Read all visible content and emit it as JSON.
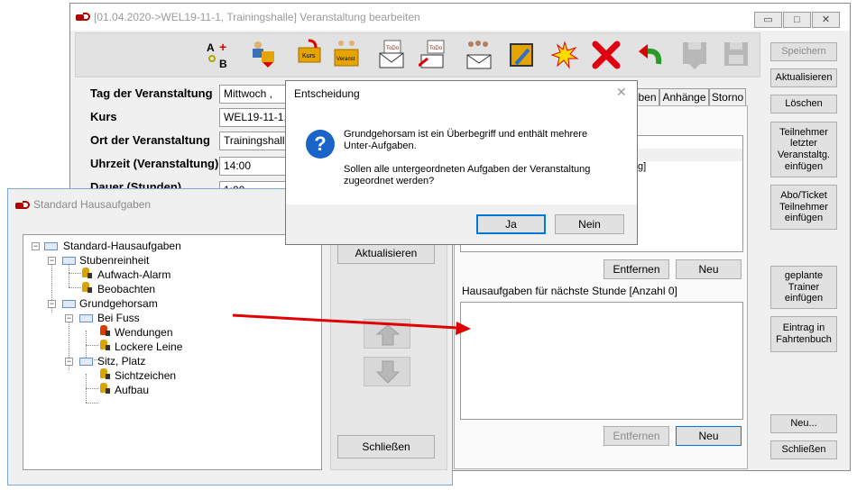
{
  "main_window": {
    "title": "[01.04.2020->WEL19-11-1, Trainingshalle] Veranstaltung bearbeiten",
    "controls": {
      "minimize": "▭",
      "maximize": "□",
      "close": "✕"
    },
    "toolbar_icons": [
      "ab-text-icon",
      "trainer-event-icon",
      "course-icon",
      "event-icon",
      "todo-mail-icon",
      "todo-send-icon",
      "group-mail-icon",
      "envelope-icon",
      "calendar-edit-icon",
      "burst-icon",
      "red-x-icon",
      "undo-arrow-icon",
      "save-disk-disabled-icon",
      "save-disk-disabled-icon"
    ],
    "toolbar_icon_texts": {
      "kurs": "Kurs",
      "veranst1": "Veranst",
      "veranst2": "Veranst",
      "todo1": "ToDo",
      "todo2": "ToDo"
    },
    "right_buttons": {
      "save": "Speichern",
      "refresh": "Aktualisieren",
      "delete": "Löschen",
      "insert_last": [
        "Teilnehmer",
        "letzter",
        "Veranstaltg.",
        "einfügen"
      ],
      "insert_abo": [
        "Abo/Ticket",
        "Teilnehmer",
        "einfügen"
      ],
      "insert_trainer": [
        "geplante",
        "Trainer",
        "einfügen"
      ],
      "logbook": [
        "Eintrag in",
        "Fahrtenbuch"
      ],
      "new": "Neu...",
      "close": "Schließen"
    },
    "fields": [
      {
        "label": "Tag der Veranstaltung",
        "value": "Mittwoch  ,   "
      },
      {
        "label": "Kurs",
        "value": "WEL19-11-1, f"
      },
      {
        "label": "Ort der Veranstaltung",
        "value": "Trainingshalle, "
      },
      {
        "label": "Uhrzeit (Veranstaltung)",
        "value": "14:00"
      },
      {
        "label": "Dauer (Stunden)",
        "value": "1:00"
      }
    ],
    "tabs": {
      "partial": "ben",
      "attachments": "Anhänge",
      "storno": "Storno"
    },
    "upper_list": {
      "row_text": "g]"
    },
    "upper_buttons": {
      "remove": "Entfernen",
      "new": "Neu"
    },
    "homework_label": "Hausaufgaben für nächste Stunde [Anzahl 0]",
    "lower_buttons": {
      "remove": "Entfernen",
      "new": "Neu"
    }
  },
  "homework_window": {
    "title": "Standard Hausaufgaben",
    "tree": [
      {
        "label": "Standard-Hausaufgaben",
        "level": 0
      },
      {
        "label": "Stubenreinheit",
        "level": 1
      },
      {
        "label": "Aufwach-Alarm",
        "level": 2
      },
      {
        "label": "Beobachten",
        "level": 2
      },
      {
        "label": "Grundgehorsam",
        "level": 1
      },
      {
        "label": "Bei Fuss",
        "level": 2
      },
      {
        "label": "Wendungen",
        "level": 3
      },
      {
        "label": "Lockere Leine",
        "level": 3
      },
      {
        "label": "Sitz, Platz",
        "level": 2
      },
      {
        "label": "Sichtzeichen",
        "level": 3
      },
      {
        "label": "Aufbau",
        "level": 3
      }
    ],
    "buttons": {
      "refresh": "Aktualisieren",
      "close": "Schließen"
    }
  },
  "dialog": {
    "title": "Entscheidung",
    "close": "✕",
    "line1": "Grundgehorsam ist ein Überbegriff und enthält mehrere",
    "line2": "Unter-Aufgaben.",
    "line3": "Sollen alle untergeordneten Aufgaben der Veranstaltung",
    "line4": "zugeordnet werden?",
    "yes": "Ja",
    "no": "Nein",
    "icon_glyph": "?"
  },
  "colors": {
    "arrow": "#e00000",
    "dialog_accent": "#0078d7",
    "question_icon": "#1a63c7"
  }
}
